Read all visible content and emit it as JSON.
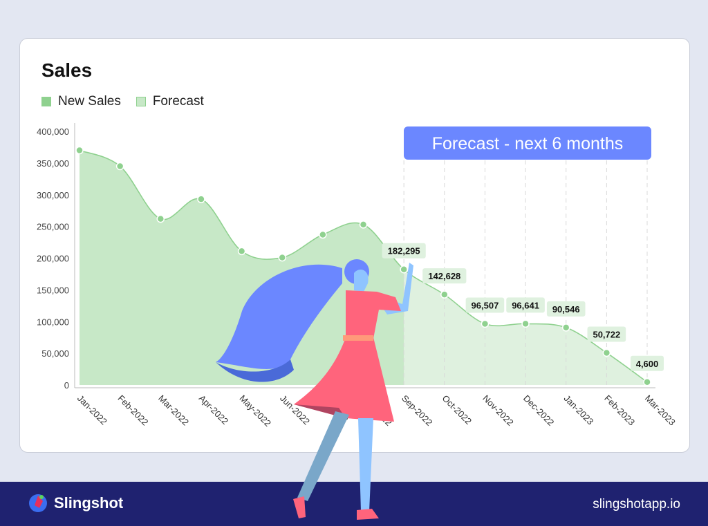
{
  "chart_data": {
    "type": "area",
    "title": "Sales",
    "legend": [
      {
        "name": "New Sales",
        "color": "#8fd18f"
      },
      {
        "name": "Forecast",
        "color": "#c7e8c7"
      }
    ],
    "legend_position": "top-left",
    "categories": [
      "Jan-2022",
      "Feb-2022",
      "Mar-2022",
      "Apr-2022",
      "May-2022",
      "Jun-2022",
      "Jul-2022",
      "Aug-2022",
      "Sep-2022",
      "Oct-2022",
      "Nov-2022",
      "Dec-2022",
      "Jan-2023",
      "Feb-2023",
      "Mar-2023"
    ],
    "values": [
      370000,
      345000,
      262000,
      293000,
      211000,
      201000,
      237000,
      253000,
      182295,
      142628,
      96507,
      96641,
      90546,
      50722,
      4600
    ],
    "data_labels": [
      "",
      "",
      "",
      "",
      "",
      "",
      "",
      "",
      "182,295",
      "142,628",
      "96,507",
      "96,641",
      "90,546",
      "50,722",
      "4,600"
    ],
    "forecast_start_index": 8,
    "yticks": [
      "0",
      "50,000",
      "100,000",
      "150,000",
      "200,000",
      "250,000",
      "300,000",
      "350,000",
      "400,000"
    ],
    "ylim": [
      0,
      400000
    ],
    "annotation": "Forecast - next 6 months",
    "colors": {
      "line": "#8fd18f",
      "actual_fill": "#c7e8c7",
      "forecast_fill": "#dff1df",
      "annotation_bg": "#6b87ff"
    }
  },
  "footer": {
    "brand": "Slingshot",
    "url": "slingshotapp.io"
  }
}
